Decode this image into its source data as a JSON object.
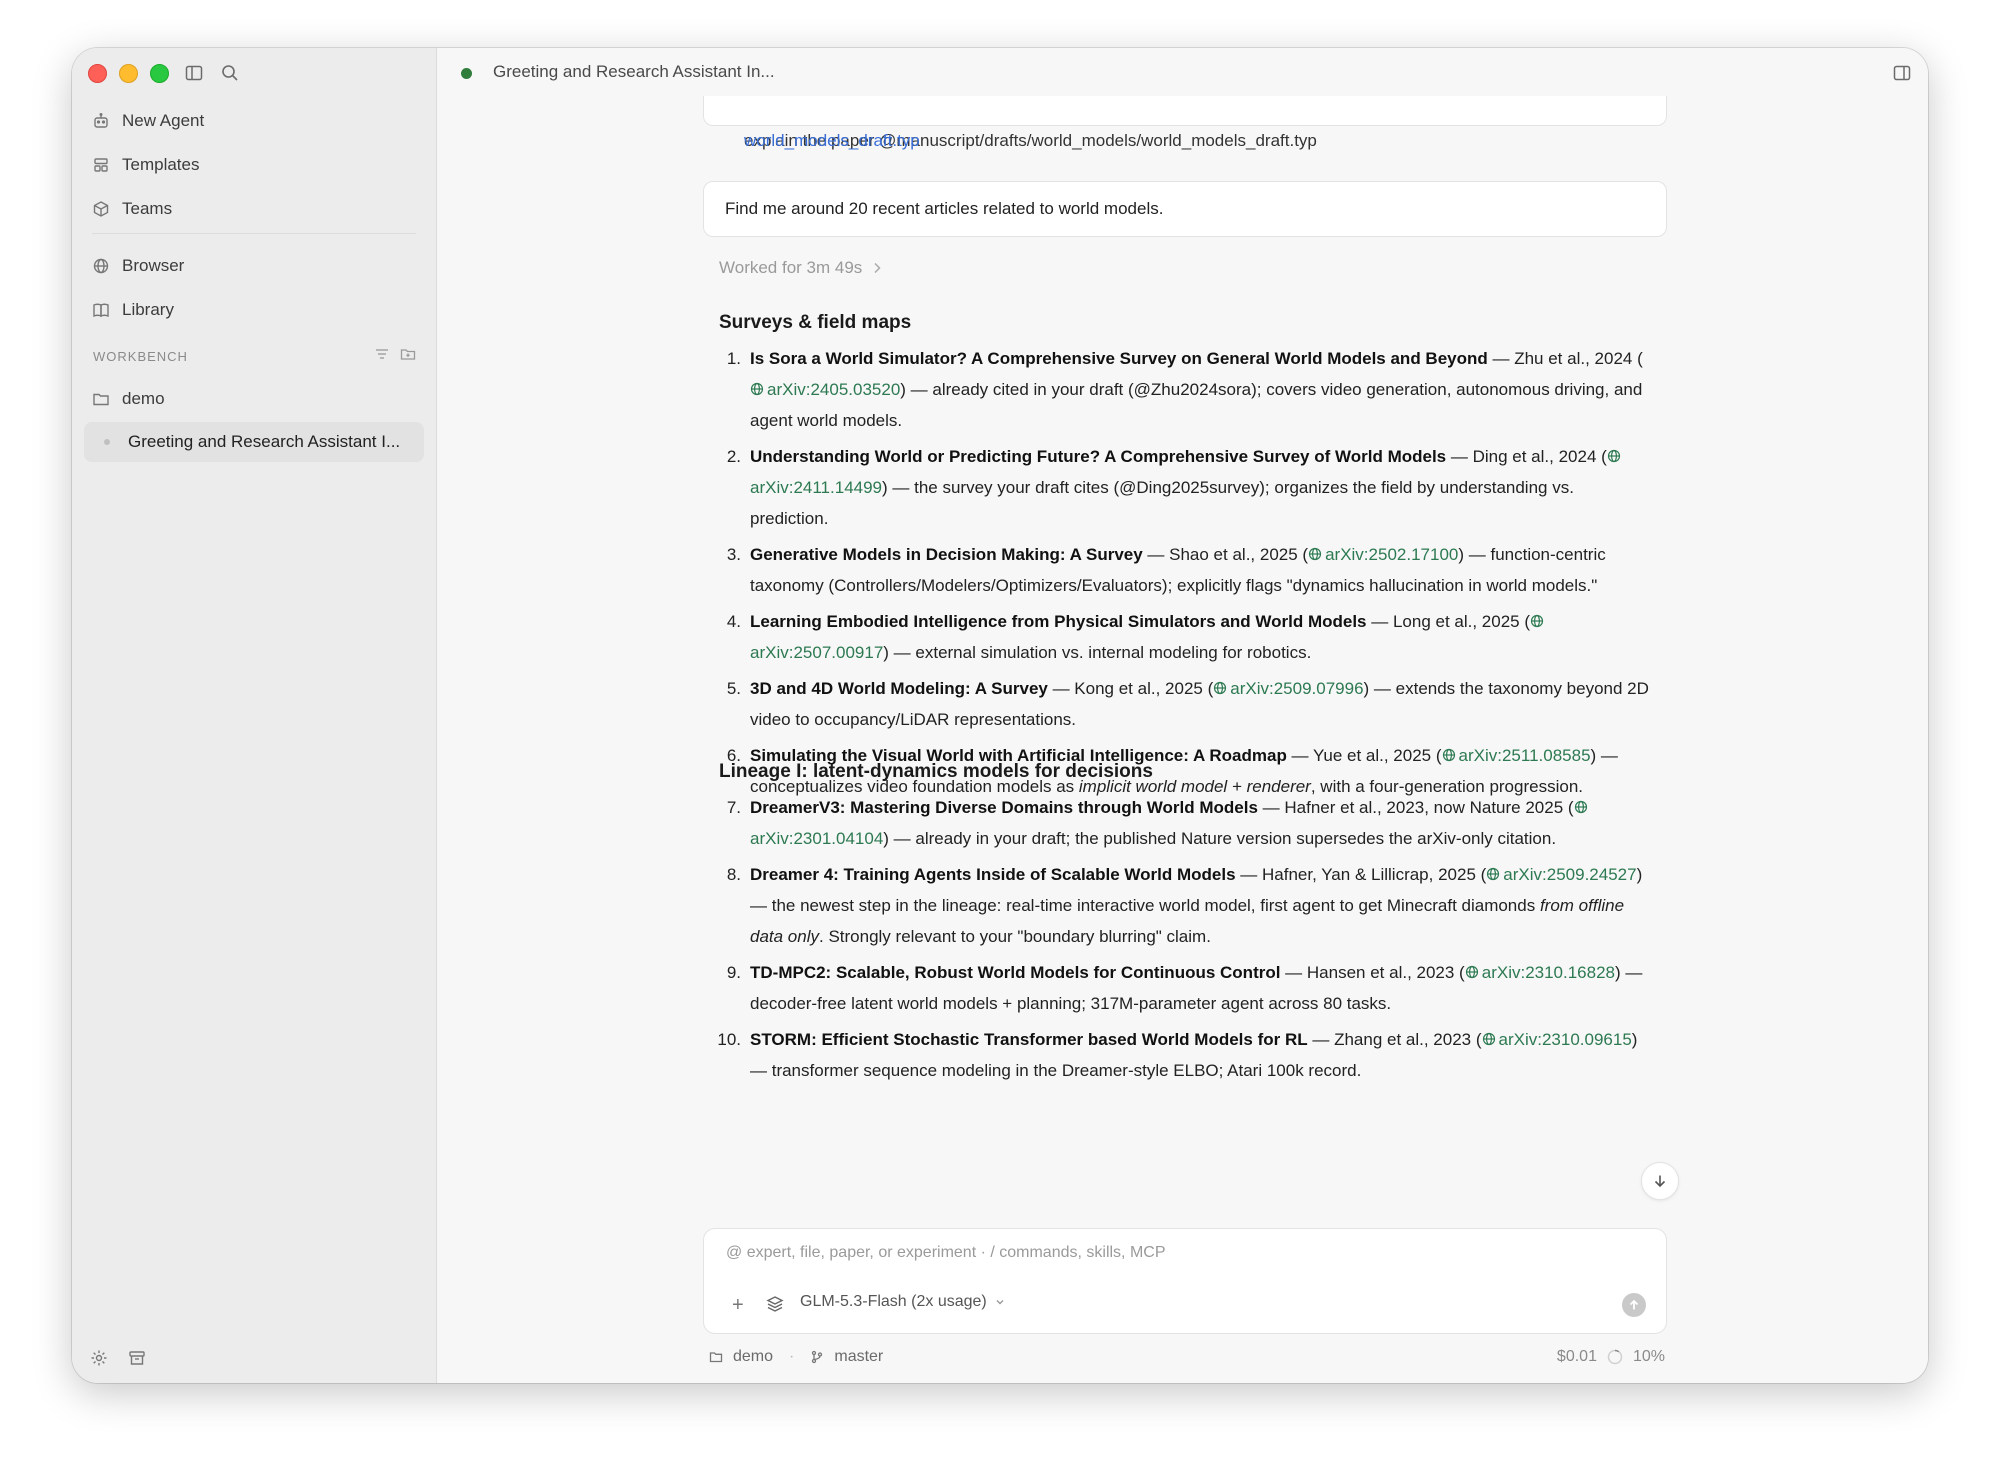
{
  "window": {
    "title": "Greeting and Research Assistant In..."
  },
  "sidebar": {
    "items": [
      {
        "label": "New Agent",
        "icon": "robot-icon"
      },
      {
        "label": "Templates",
        "icon": "templates-icon"
      },
      {
        "label": "Teams",
        "icon": "cube-icon"
      },
      {
        "label": "Browser",
        "icon": "globe-icon"
      },
      {
        "label": "Library",
        "icon": "book-icon"
      }
    ],
    "workbench_label": "WORKBENCH",
    "folder": "demo",
    "thread": "Greeting and Research Assistant I..."
  },
  "chat": {
    "prev_message": "explain the paper @manuscript/drafts/world_models/world_models_draft.typ",
    "prev_message_link": "world_models_draft.typ",
    "user_message": "Find me around 20 recent articles related to world models.",
    "worked": "Worked for 3m 49s",
    "sections": [
      {
        "heading": "Surveys & field maps",
        "items": [
          {
            "num": "1.",
            "title": "Is Sora a World Simulator? A Comprehensive Survey on General World Models and Beyond",
            "pre": " — Zhu et al., 2024 (",
            "arxiv": "arXiv:2405.03520",
            "post": ") — already cited in your draft (@Zhu2024sora); covers video generation, autonomous driving, and agent world models."
          },
          {
            "num": "2.",
            "title": "Understanding World or Predicting Future? A Comprehensive Survey of World Models",
            "pre": " — Ding et al., 2024 (",
            "arxiv": "arXiv:2411.14499",
            "post": ") — the survey your draft cites (@Ding2025survey); organizes the field by understanding vs. prediction."
          },
          {
            "num": "3.",
            "title": "Generative Models in Decision Making: A Survey",
            "pre": " — Shao et al., 2025 (",
            "arxiv": "arXiv:2502.17100",
            "post": ") — function-centric taxonomy (Controllers/Modelers/Optimizers/Evaluators); explicitly flags \"dynamics hallucination in world models.\""
          },
          {
            "num": "4.",
            "title": "Learning Embodied Intelligence from Physical Simulators and World Models",
            "pre": " — Long et al., 2025 (",
            "arxiv": "arXiv:2507.00917",
            "post": ") — external simulation vs. internal modeling for robotics."
          },
          {
            "num": "5.",
            "title": "3D and 4D World Modeling: A Survey",
            "pre": " — Kong et al., 2025 (",
            "arxiv": "arXiv:2509.07996",
            "post": ") — extends the taxonomy beyond 2D video to occupancy/LiDAR representations."
          },
          {
            "num": "6.",
            "title": "Simulating the Visual World with Artificial Intelligence: A Roadmap",
            "pre": " — Yue et al., 2025 (",
            "arxiv": "arXiv:2511.08585",
            "post": ") — conceptualizes video foundation models as ",
            "emph": "implicit world model + renderer",
            "post2": ", with a four-generation progression."
          }
        ]
      },
      {
        "heading": "Lineage I: latent-dynamics models for decisions",
        "items": [
          {
            "num": "7.",
            "title": "DreamerV3: Mastering Diverse Domains through World Models",
            "pre": " — Hafner et al., 2023, now Nature 2025 (",
            "arxiv": "arXiv:2301.04104",
            "post": ") — already in your draft; the published Nature version supersedes the arXiv-only citation."
          },
          {
            "num": "8.",
            "title": "Dreamer 4: Training Agents Inside of Scalable World Models",
            "pre": " — Hafner, Yan & Lillicrap, 2025 (",
            "arxiv": "arXiv:2509.24527",
            "post": ") — the newest step in the lineage: real-time interactive world model, first agent to get Minecraft diamonds ",
            "emph": "from offline data only",
            "post2": ". Strongly relevant to your \"boundary blurring\" claim."
          },
          {
            "num": "9.",
            "title": "TD-MPC2: Scalable, Robust World Models for Continuous Control",
            "pre": " — Hansen et al., 2023 (",
            "arxiv": "arXiv:2310.16828",
            "post": ") — decoder-free latent world models + planning; 317M-parameter agent across 80 tasks."
          },
          {
            "num": "10.",
            "title": "STORM: Efficient Stochastic Transformer based World Models for RL",
            "pre": " — Zhang et al., 2023 (",
            "arxiv": "arXiv:2310.09615",
            "post": ") — transformer sequence modeling in the Dreamer-style ELBO; Atari 100k record."
          }
        ]
      }
    ]
  },
  "composer": {
    "placeholder": "@ expert, file, paper, or experiment · / commands, skills, MCP",
    "model": "GLM-5.3-Flash (2x usage)"
  },
  "footer": {
    "folder": "demo",
    "branch": "master",
    "cost": "$0.01",
    "context": "10%"
  },
  "colors": {
    "arxiv_link": "#2d7a52",
    "status_dot": "#2f7d3b"
  }
}
